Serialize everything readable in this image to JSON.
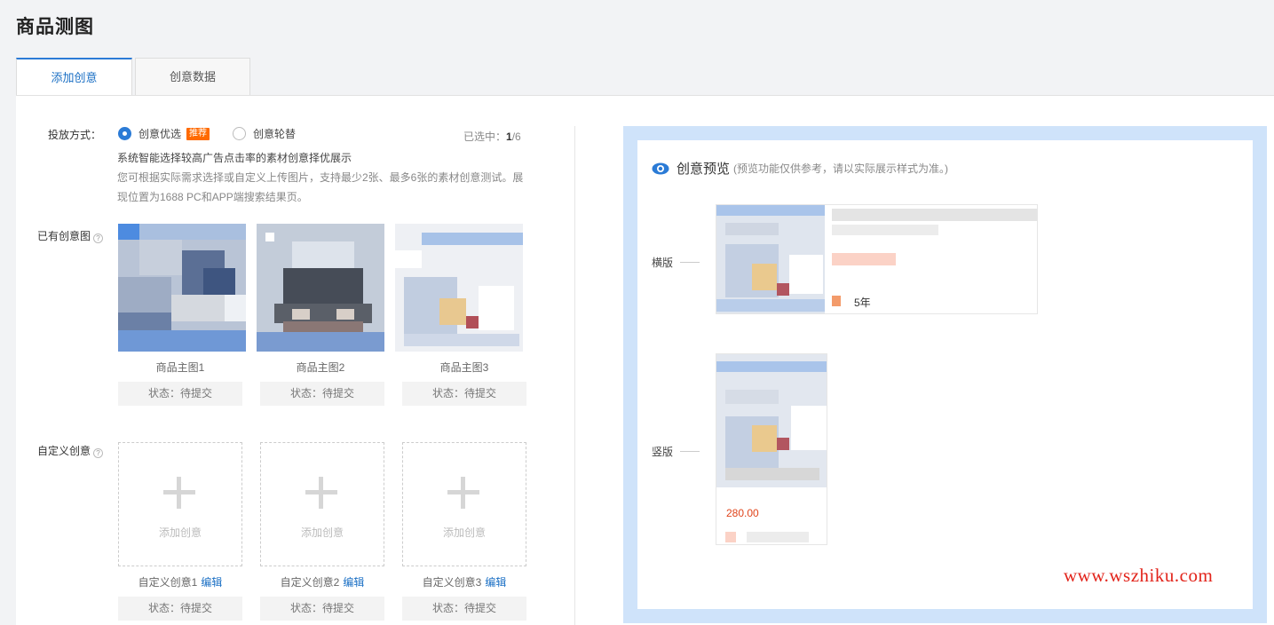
{
  "page": {
    "title": "商品测图"
  },
  "tabs": [
    {
      "label": "添加创意",
      "active": true
    },
    {
      "label": "创意数据",
      "active": false
    }
  ],
  "delivery": {
    "label": "投放方式：",
    "option_optimize": "创意优选",
    "recommend_tag": "推荐",
    "option_rotate": "创意轮替",
    "selected_label": "已选中：",
    "selected_num": "1",
    "selected_total": "/6",
    "desc_primary": "系统智能选择较高广告点击率的素材创意择优展示",
    "desc_secondary": "您可根据实际需求选择或自定义上传图片，支持最少2张、最多6张的素材创意测试。展现位置为1688 PC和APP端搜索结果页。"
  },
  "existing": {
    "label": "已有创意图",
    "help": "?",
    "items": [
      {
        "caption": "商品主图1",
        "status": "状态：待提交"
      },
      {
        "caption": "商品主图2",
        "status": "状态：待提交"
      },
      {
        "caption": "商品主图3",
        "status": "状态：待提交"
      }
    ]
  },
  "custom": {
    "label": "自定义创意",
    "help": "?",
    "add_label": "添加创意",
    "edit_label": "编辑",
    "items": [
      {
        "caption": "自定义创意1",
        "status": "状态：待提交"
      },
      {
        "caption": "自定义创意2",
        "status": "状态：待提交"
      },
      {
        "caption": "自定义创意3",
        "status": "状态：待提交"
      }
    ]
  },
  "preview": {
    "title": "创意预览",
    "note": "(预览功能仅供参考，请以实际展示样式为准。)",
    "horizontal_label": "横版",
    "vertical_label": "竖版",
    "horizontal_years": "5年",
    "vertical_price": "280.00"
  },
  "watermark": "www.wszhiku.com",
  "colors": {
    "accent": "#2b7bd6",
    "recommend": "#ff6a00",
    "preview_frame": "#cfe3fa",
    "price": "#e0441b",
    "watermark": "#e2231a"
  }
}
